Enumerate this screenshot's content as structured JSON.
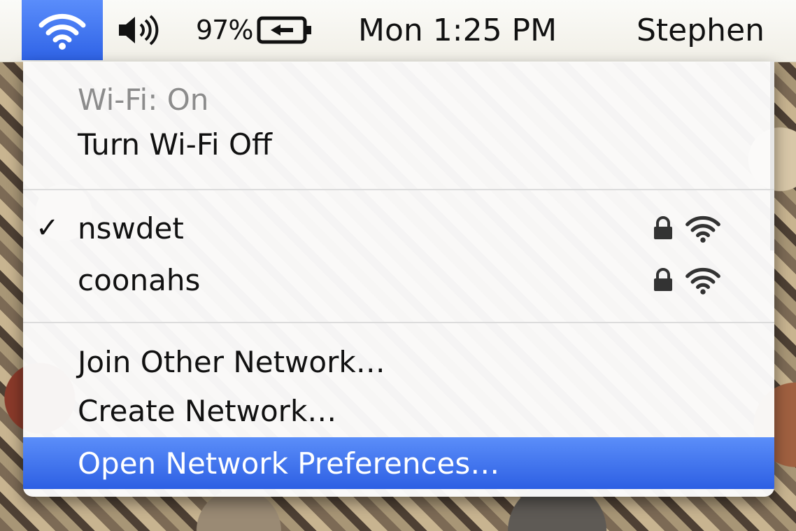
{
  "menubar": {
    "wifi_icon": "wifi-icon",
    "volume_icon": "volume-icon",
    "battery_percent": "97%",
    "battery_icon": "battery-charging-icon",
    "clock": "Mon 1:25 PM",
    "user": "Stephen"
  },
  "wifi_menu": {
    "status": "Wi-Fi: On",
    "toggle": "Turn Wi-Fi Off",
    "networks": [
      {
        "name": "nswdet",
        "selected": true,
        "secured": true
      },
      {
        "name": "coonahs",
        "selected": false,
        "secured": true
      }
    ],
    "join_other": "Join Other Network…",
    "create_network": "Create Network…",
    "open_preferences": "Open Network Preferences…"
  },
  "colors": {
    "highlight": "#3366ee",
    "menubar": "#f6f4ee"
  }
}
